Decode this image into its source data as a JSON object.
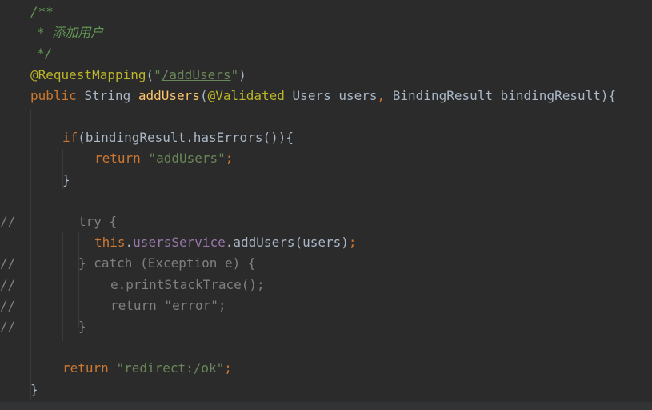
{
  "editor": {
    "lines": [
      {
        "gutter": "",
        "indent": 38,
        "tokens": [
          {
            "t": "/**",
            "c": "t-comment"
          }
        ]
      },
      {
        "gutter": "",
        "indent": 46,
        "tokens": [
          {
            "t": "* 添加用户",
            "c": "t-comment"
          }
        ]
      },
      {
        "gutter": "",
        "indent": 46,
        "tokens": [
          {
            "t": "*/",
            "c": "t-comment"
          }
        ]
      },
      {
        "gutter": "",
        "indent": 38,
        "tokens": [
          {
            "t": "@RequestMapping",
            "c": "t-annot"
          },
          {
            "t": "(",
            "c": "t-plain"
          },
          {
            "t": "\"",
            "c": "t-str"
          },
          {
            "t": "/addUsers",
            "c": "t-link"
          },
          {
            "t": "\"",
            "c": "t-str"
          },
          {
            "t": ")",
            "c": "t-plain"
          }
        ]
      },
      {
        "gutter": "",
        "indent": 38,
        "tokens": [
          {
            "t": "public ",
            "c": "t-kw"
          },
          {
            "t": "String ",
            "c": "t-plain"
          },
          {
            "t": "addUsers",
            "c": "t-fn"
          },
          {
            "t": "(",
            "c": "t-plain"
          },
          {
            "t": "@Validated ",
            "c": "t-annot"
          },
          {
            "t": "Users users",
            "c": "t-plain"
          },
          {
            "t": ", ",
            "c": "t-kw"
          },
          {
            "t": "BindingResult bindingResult){",
            "c": "t-plain"
          }
        ]
      },
      {
        "gutter": "",
        "indent": 38,
        "tokens": []
      },
      {
        "gutter": "",
        "indent": 78,
        "tokens": [
          {
            "t": "if",
            "c": "t-kw"
          },
          {
            "t": "(bindingResult.hasErrors()){",
            "c": "t-plain"
          }
        ]
      },
      {
        "gutter": "",
        "indent": 118,
        "tokens": [
          {
            "t": "return ",
            "c": "t-kw"
          },
          {
            "t": "\"addUsers\"",
            "c": "t-str"
          },
          {
            "t": ";",
            "c": "t-kw"
          }
        ]
      },
      {
        "gutter": "",
        "indent": 78,
        "tokens": [
          {
            "t": "}",
            "c": "t-plain"
          }
        ]
      },
      {
        "gutter": "",
        "indent": 38,
        "tokens": []
      },
      {
        "gutter": "//",
        "indent": 98,
        "tokens": [
          {
            "t": "try {",
            "c": "t-gray"
          }
        ]
      },
      {
        "gutter": "",
        "indent": 118,
        "tokens": [
          {
            "t": "this",
            "c": "t-kw"
          },
          {
            "t": ".",
            "c": "t-plain"
          },
          {
            "t": "usersService",
            "c": "t-field"
          },
          {
            "t": ".addUsers(users)",
            "c": "t-plain"
          },
          {
            "t": ";",
            "c": "t-kw"
          }
        ]
      },
      {
        "gutter": "//",
        "indent": 98,
        "tokens": [
          {
            "t": "} catch (Exception e) {",
            "c": "t-gray"
          }
        ]
      },
      {
        "gutter": "//",
        "indent": 138,
        "tokens": [
          {
            "t": "e.printStackTrace();",
            "c": "t-gray"
          }
        ]
      },
      {
        "gutter": "//",
        "indent": 138,
        "tokens": [
          {
            "t": "return \"error\";",
            "c": "t-gray"
          }
        ]
      },
      {
        "gutter": "//",
        "indent": 98,
        "tokens": [
          {
            "t": "}",
            "c": "t-gray"
          }
        ]
      },
      {
        "gutter": "",
        "indent": 38,
        "tokens": []
      },
      {
        "gutter": "",
        "indent": 78,
        "tokens": [
          {
            "t": "return ",
            "c": "t-kw"
          },
          {
            "t": "\"redirect:/ok\"",
            "c": "t-str"
          },
          {
            "t": ";",
            "c": "t-kw"
          }
        ]
      },
      {
        "gutter": "",
        "indent": 38,
        "tokens": [
          {
            "t": "}",
            "c": "t-plain"
          }
        ]
      }
    ]
  }
}
